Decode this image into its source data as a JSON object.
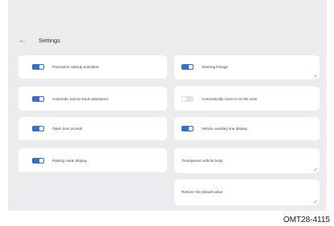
{
  "header": {
    "back_icon": "arrow-left-icon",
    "title": "Settings"
  },
  "left_column": [
    {
      "label": "Panoramic startup animation",
      "on": true
    },
    {
      "label": "Automatic narrow track assistance",
      "on": true
    },
    {
      "label": "Open door prompt",
      "on": true
    },
    {
      "label": "Parking radar display",
      "on": true
    }
  ],
  "right_column": {
    "steering_linkage": {
      "label": "Steering linkage",
      "on": true
    },
    "auto_zoom": {
      "label": "Automatically zoom in on the view",
      "on": false
    },
    "aux_line": {
      "label": "Vehicle auxiliary line display",
      "on": true
    },
    "transparent_body": {
      "label": "Transparent vehicle body"
    },
    "restore_default": {
      "label": "Restore the default value"
    }
  },
  "colors": {
    "accent": "#2f6fd0",
    "screen_bg": "#ececee",
    "card_bg": "#ffffff"
  },
  "figure_code": "OMT28-4115"
}
